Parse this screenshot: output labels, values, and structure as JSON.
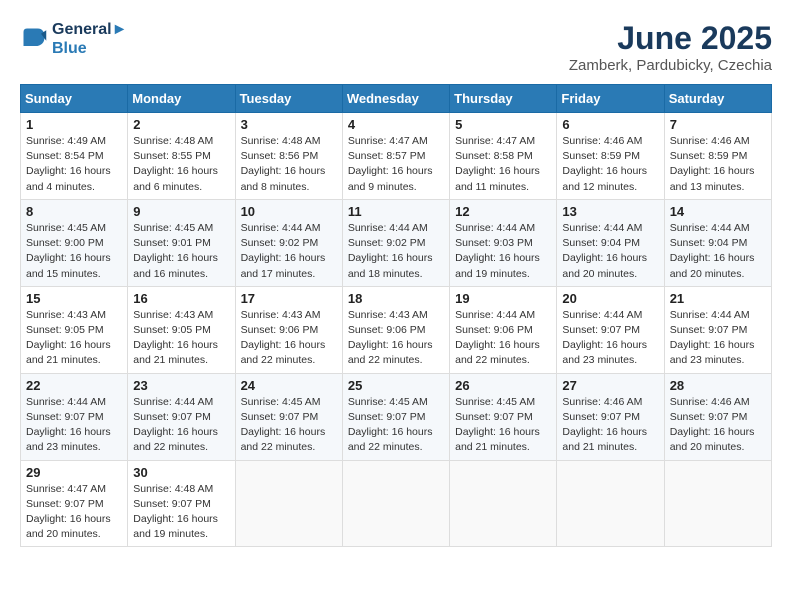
{
  "logo": {
    "line1": "General",
    "line2": "Blue"
  },
  "title": "June 2025",
  "subtitle": "Zamberk, Pardubicky, Czechia",
  "header_days": [
    "Sunday",
    "Monday",
    "Tuesday",
    "Wednesday",
    "Thursday",
    "Friday",
    "Saturday"
  ],
  "weeks": [
    [
      {
        "day": "1",
        "info": "Sunrise: 4:49 AM\nSunset: 8:54 PM\nDaylight: 16 hours\nand 4 minutes."
      },
      {
        "day": "2",
        "info": "Sunrise: 4:48 AM\nSunset: 8:55 PM\nDaylight: 16 hours\nand 6 minutes."
      },
      {
        "day": "3",
        "info": "Sunrise: 4:48 AM\nSunset: 8:56 PM\nDaylight: 16 hours\nand 8 minutes."
      },
      {
        "day": "4",
        "info": "Sunrise: 4:47 AM\nSunset: 8:57 PM\nDaylight: 16 hours\nand 9 minutes."
      },
      {
        "day": "5",
        "info": "Sunrise: 4:47 AM\nSunset: 8:58 PM\nDaylight: 16 hours\nand 11 minutes."
      },
      {
        "day": "6",
        "info": "Sunrise: 4:46 AM\nSunset: 8:59 PM\nDaylight: 16 hours\nand 12 minutes."
      },
      {
        "day": "7",
        "info": "Sunrise: 4:46 AM\nSunset: 8:59 PM\nDaylight: 16 hours\nand 13 minutes."
      }
    ],
    [
      {
        "day": "8",
        "info": "Sunrise: 4:45 AM\nSunset: 9:00 PM\nDaylight: 16 hours\nand 15 minutes."
      },
      {
        "day": "9",
        "info": "Sunrise: 4:45 AM\nSunset: 9:01 PM\nDaylight: 16 hours\nand 16 minutes."
      },
      {
        "day": "10",
        "info": "Sunrise: 4:44 AM\nSunset: 9:02 PM\nDaylight: 16 hours\nand 17 minutes."
      },
      {
        "day": "11",
        "info": "Sunrise: 4:44 AM\nSunset: 9:02 PM\nDaylight: 16 hours\nand 18 minutes."
      },
      {
        "day": "12",
        "info": "Sunrise: 4:44 AM\nSunset: 9:03 PM\nDaylight: 16 hours\nand 19 minutes."
      },
      {
        "day": "13",
        "info": "Sunrise: 4:44 AM\nSunset: 9:04 PM\nDaylight: 16 hours\nand 20 minutes."
      },
      {
        "day": "14",
        "info": "Sunrise: 4:44 AM\nSunset: 9:04 PM\nDaylight: 16 hours\nand 20 minutes."
      }
    ],
    [
      {
        "day": "15",
        "info": "Sunrise: 4:43 AM\nSunset: 9:05 PM\nDaylight: 16 hours\nand 21 minutes."
      },
      {
        "day": "16",
        "info": "Sunrise: 4:43 AM\nSunset: 9:05 PM\nDaylight: 16 hours\nand 21 minutes."
      },
      {
        "day": "17",
        "info": "Sunrise: 4:43 AM\nSunset: 9:06 PM\nDaylight: 16 hours\nand 22 minutes."
      },
      {
        "day": "18",
        "info": "Sunrise: 4:43 AM\nSunset: 9:06 PM\nDaylight: 16 hours\nand 22 minutes."
      },
      {
        "day": "19",
        "info": "Sunrise: 4:44 AM\nSunset: 9:06 PM\nDaylight: 16 hours\nand 22 minutes."
      },
      {
        "day": "20",
        "info": "Sunrise: 4:44 AM\nSunset: 9:07 PM\nDaylight: 16 hours\nand 23 minutes."
      },
      {
        "day": "21",
        "info": "Sunrise: 4:44 AM\nSunset: 9:07 PM\nDaylight: 16 hours\nand 23 minutes."
      }
    ],
    [
      {
        "day": "22",
        "info": "Sunrise: 4:44 AM\nSunset: 9:07 PM\nDaylight: 16 hours\nand 23 minutes."
      },
      {
        "day": "23",
        "info": "Sunrise: 4:44 AM\nSunset: 9:07 PM\nDaylight: 16 hours\nand 22 minutes."
      },
      {
        "day": "24",
        "info": "Sunrise: 4:45 AM\nSunset: 9:07 PM\nDaylight: 16 hours\nand 22 minutes."
      },
      {
        "day": "25",
        "info": "Sunrise: 4:45 AM\nSunset: 9:07 PM\nDaylight: 16 hours\nand 22 minutes."
      },
      {
        "day": "26",
        "info": "Sunrise: 4:45 AM\nSunset: 9:07 PM\nDaylight: 16 hours\nand 21 minutes."
      },
      {
        "day": "27",
        "info": "Sunrise: 4:46 AM\nSunset: 9:07 PM\nDaylight: 16 hours\nand 21 minutes."
      },
      {
        "day": "28",
        "info": "Sunrise: 4:46 AM\nSunset: 9:07 PM\nDaylight: 16 hours\nand 20 minutes."
      }
    ],
    [
      {
        "day": "29",
        "info": "Sunrise: 4:47 AM\nSunset: 9:07 PM\nDaylight: 16 hours\nand 20 minutes."
      },
      {
        "day": "30",
        "info": "Sunrise: 4:48 AM\nSunset: 9:07 PM\nDaylight: 16 hours\nand 19 minutes."
      },
      null,
      null,
      null,
      null,
      null
    ]
  ]
}
